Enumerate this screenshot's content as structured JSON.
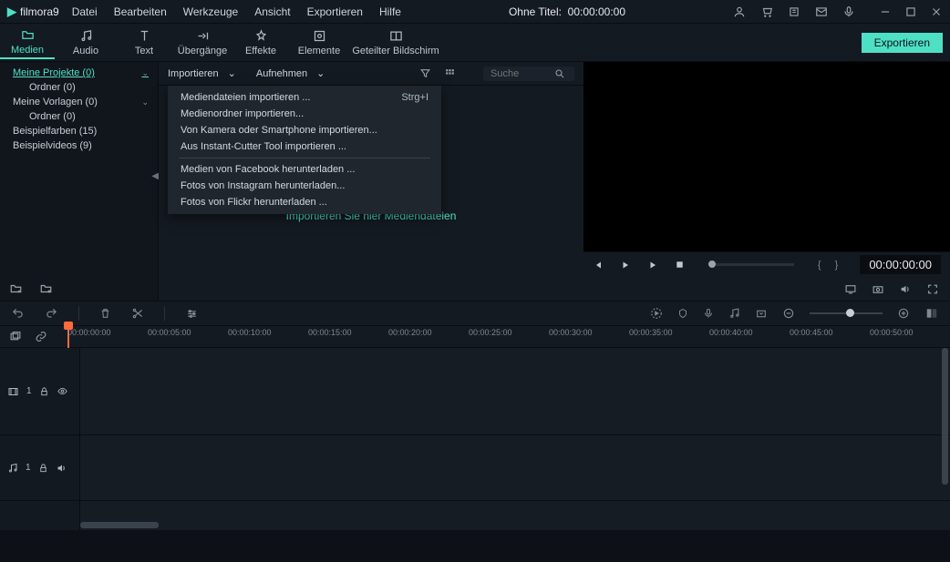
{
  "logo": {
    "text": "filmora9"
  },
  "menu": {
    "items": [
      "Datei",
      "Bearbeiten",
      "Werkzeuge",
      "Ansicht",
      "Exportieren",
      "Hilfe"
    ]
  },
  "title": {
    "text": "Ohne Titel:",
    "time": "00:00:00:00"
  },
  "tabs": [
    {
      "label": "Medien"
    },
    {
      "label": "Audio"
    },
    {
      "label": "Text"
    },
    {
      "label": "Übergänge"
    },
    {
      "label": "Effekte"
    },
    {
      "label": "Elemente"
    },
    {
      "label": "Geteilter Bildschirm"
    }
  ],
  "export_label": "Exportieren",
  "sidebar": {
    "items": [
      {
        "label": "Meine Projekte (0)",
        "sel": true,
        "chev": true
      },
      {
        "label": "Ordner (0)",
        "child": true
      },
      {
        "label": "Meine Vorlagen (0)",
        "chev": true
      },
      {
        "label": "Ordner (0)",
        "child": true
      },
      {
        "label": "Beispielfarben (15)"
      },
      {
        "label": "Beispielvideos (9)"
      }
    ]
  },
  "mediabar": {
    "import": "Importieren",
    "record": "Aufnehmen"
  },
  "search": {
    "placeholder": "Suche"
  },
  "dropdown": {
    "items": [
      {
        "label": "Mediendateien importieren ...",
        "shortcut": "Strg+I"
      },
      {
        "label": "Medienordner importieren..."
      },
      {
        "label": "Von Kamera oder Smartphone importieren..."
      },
      {
        "label": "Aus Instant-Cutter Tool importieren ..."
      }
    ],
    "items2": [
      {
        "label": "Medien von Facebook herunterladen ..."
      },
      {
        "label": "Fotos von Instagram herunterladen..."
      },
      {
        "label": "Fotos von Flickr herunterladen ..."
      }
    ]
  },
  "drop_hint": "Importieren Sie hier Mediendateien",
  "preview": {
    "time": "00:00:00:00"
  },
  "ruler": [
    "00:00:00:00",
    "00:00:05:00",
    "00:00:10:00",
    "00:00:15:00",
    "00:00:20:00",
    "00:00:25:00",
    "00:00:30:00",
    "00:00:35:00",
    "00:00:40:00",
    "00:00:45:00",
    "00:00:50:00"
  ],
  "tracks": {
    "video": "1",
    "audio": "1"
  }
}
